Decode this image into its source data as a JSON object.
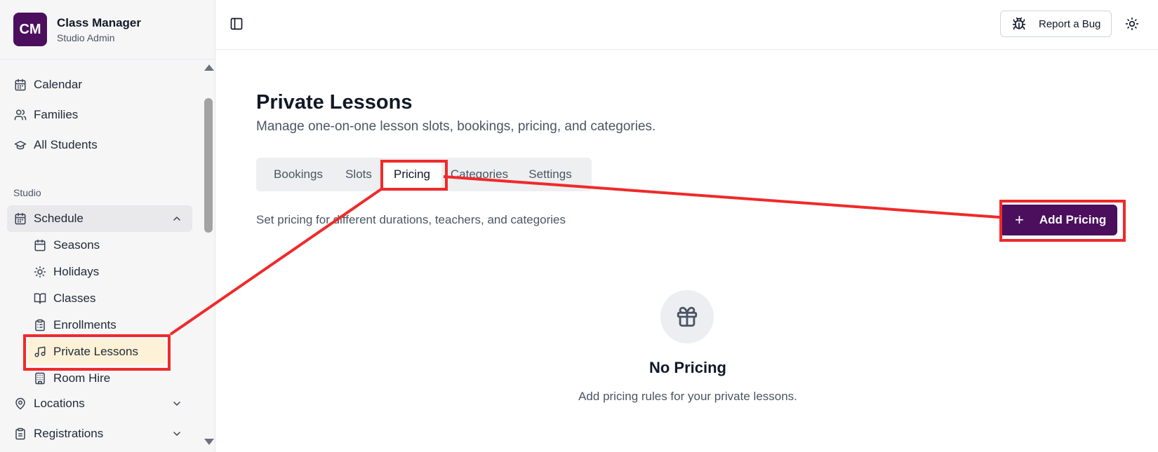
{
  "app": {
    "logo_text": "CM",
    "title": "Class Manager",
    "subtitle": "Studio Admin"
  },
  "sidebar": {
    "top_items": [
      {
        "label": "Calendar",
        "icon": "calendar-icon"
      },
      {
        "label": "Families",
        "icon": "users-icon"
      },
      {
        "label": "All Students",
        "icon": "graduation-cap-icon"
      }
    ],
    "section_label": "Studio",
    "schedule": {
      "label": "Schedule",
      "icon": "calendar-icon",
      "expanded": true
    },
    "schedule_children": [
      {
        "label": "Seasons",
        "icon": "calendar-icon"
      },
      {
        "label": "Holidays",
        "icon": "sun-icon"
      },
      {
        "label": "Classes",
        "icon": "book-open-icon"
      },
      {
        "label": "Enrollments",
        "icon": "clipboard-list-icon"
      },
      {
        "label": "Private Lessons",
        "icon": "music-icon",
        "selected": true
      },
      {
        "label": "Room Hire",
        "icon": "building-icon"
      }
    ],
    "bottom_items": [
      {
        "label": "Locations",
        "icon": "map-pin-icon"
      },
      {
        "label": "Registrations",
        "icon": "clipboard-icon"
      }
    ]
  },
  "header": {
    "report_bug_label": "Report a Bug"
  },
  "main": {
    "title": "Private Lessons",
    "subtitle": "Manage one-on-one lesson slots, bookings, pricing, and categories.",
    "tabs": [
      {
        "label": "Bookings",
        "active": false
      },
      {
        "label": "Slots",
        "active": false
      },
      {
        "label": "Pricing",
        "active": true
      },
      {
        "label": "Categories",
        "active": false
      },
      {
        "label": "Settings",
        "active": false
      }
    ],
    "description": "Set pricing for different durations, teachers, and categories",
    "add_button_label": "Add Pricing",
    "empty_state": {
      "title": "No Pricing",
      "message": "Add pricing rules for your private lessons."
    }
  },
  "colors": {
    "brand": "#4b0f5e",
    "annotation": "#ef2a2a",
    "selected_bg": "#fdf2d7"
  }
}
